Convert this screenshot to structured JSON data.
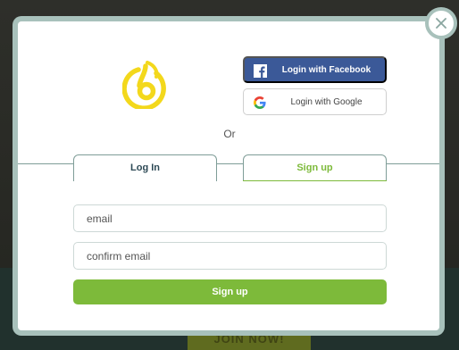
{
  "background": {
    "cta_label": "JOIN NOW!"
  },
  "modal": {
    "close_icon": "close-icon",
    "logo_icon": "b-swirl-logo",
    "facebook_label": "Login with Facebook",
    "google_label": "Login with Google",
    "or_text": "Or",
    "tabs": [
      {
        "label": "Log In",
        "active": false
      },
      {
        "label": "Sign up",
        "active": true
      }
    ],
    "email_placeholder": "email",
    "confirm_email_placeholder": "confirm email",
    "submit_label": "Sign up"
  },
  "colors": {
    "accent_green": "#7dba3a",
    "facebook_blue": "#3b5998",
    "logo_yellow": "#f3d81c",
    "frame": "#a8c1bb"
  }
}
